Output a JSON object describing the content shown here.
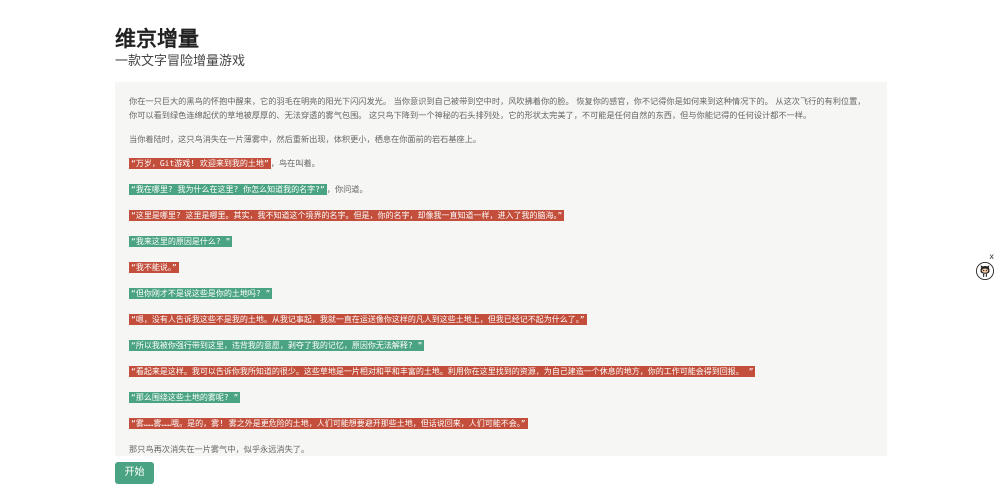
{
  "header": {
    "title": "维京增量",
    "subtitle": "一款文字冒险增量游戏"
  },
  "story": {
    "intro": "你在一只巨大的黑鸟的怀抱中醒来，它的羽毛在明亮的阳光下闪闪发光。 当你意识到自己被带到空中时，风吹拂着你的脸。 恢复你的感官，你不记得你是如何来到这种情况下的。 从这次飞行的有利位置，你可以看到绿色连绵起伏的草地被厚厚的、无法穿透的雾气包围。 这只鸟下降到一个神秘的石头排列处，它的形状太完美了，不可能是任何自然的东西，但与你能记得的任何设计都不一样。",
    "landing": "当你着陆时，这只鸟消失在一片薄雾中，然后重新出现，体积更小，栖息在你面前的岩石基座上。",
    "lines": [
      {
        "text": "“万岁，Git游戏! 欢迎来到我的土地”",
        "after": "，鸟在叫着。",
        "color": "red"
      },
      {
        "text": "“我在哪里? 我为什么在这里? 你怎么知道我的名字?”",
        "after": "，你问道。",
        "color": "green"
      },
      {
        "text": "“这里是哪里? 这里是哪里。其实，我不知道这个境界的名字。但是，你的名字，却像我一直知道一样，进入了我的脑海。”",
        "after": "",
        "color": "red"
      },
      {
        "text": "“我来这里的原因是什么? ”",
        "after": "",
        "color": "green"
      },
      {
        "text": "“我不能说。”",
        "after": "",
        "color": "red"
      },
      {
        "text": "“但你刚才不是说这些是你的土地吗? ”",
        "after": "",
        "color": "green"
      },
      {
        "text": "“嗯，没有人告诉我这些不是我的土地。从我记事起，我就一直在运送像你这样的凡人到这些土地上，但我已经记不起为什么了。”",
        "after": "",
        "color": "red"
      },
      {
        "text": "“所以我被你强行带到这里，违背我的意愿，剥夺了我的记忆，原因你无法解释? ”",
        "after": "",
        "color": "green"
      },
      {
        "text": "“看起来是这样。我可以告诉你我所知道的很少。这些草地是一片相对和平和丰富的土地。利用你在这里找到的资源，为自己建造一个休息的地方，你的工作可能会得到回报。 ”",
        "after": "",
        "color": "red"
      },
      {
        "text": "“那么围绕这些土地的雾呢? ”",
        "after": "",
        "color": "green"
      },
      {
        "text": "“雾……雾……哦。是的，雾! 雾之外是更危险的土地，人们可能想要避开那些土地，但话说回来，人们可能不会。”",
        "after": "",
        "color": "red"
      }
    ],
    "ending": "那只鸟再次消失在一片雾气中，似乎永远消失了。"
  },
  "start_button": "开始",
  "side_widget": {
    "close": "x",
    "icon": "github-octocat-icon"
  },
  "colors": {
    "red": "#c24e3b",
    "green": "#4aa382",
    "panel": "#f6f6f4"
  }
}
